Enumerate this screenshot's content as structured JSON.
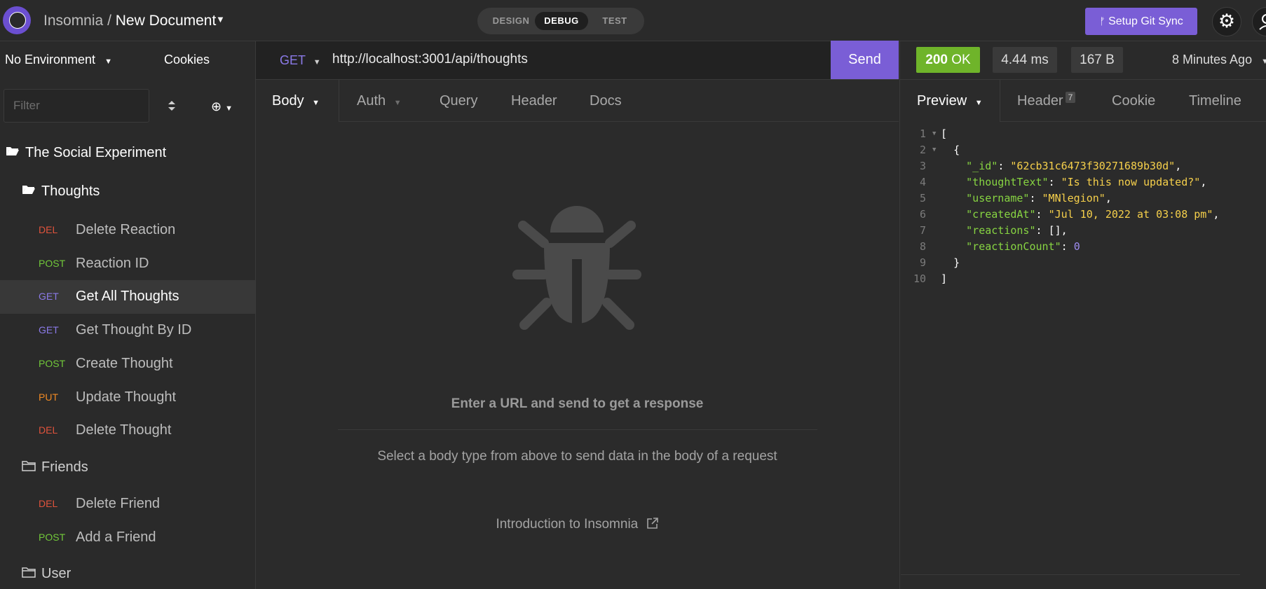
{
  "colors": {
    "accent": "#7a5ed6",
    "status_ok": "#6fb42a",
    "method_get": "#8b7ae8",
    "method_post": "#72c93a",
    "method_put": "#f08a24",
    "method_del": "#e0533c"
  },
  "header": {
    "app_name": "Insomnia",
    "separator": "/",
    "document_name": "New Document",
    "modes": {
      "design": "DESIGN",
      "debug": "DEBUG",
      "test": "TEST"
    },
    "git_sync_label": "Setup Git Sync",
    "icons": {
      "logo": "insomnia-logo",
      "git": "git-branch-icon",
      "settings": "gear-icon",
      "account": "user-icon"
    }
  },
  "sidebar": {
    "environment": "No Environment",
    "cookies": "Cookies",
    "filter_placeholder": "Filter",
    "workspace": "The Social Experiment",
    "folders": [
      {
        "name": "Thoughts"
      },
      {
        "name": "Friends"
      },
      {
        "name": "User"
      }
    ],
    "requests": [
      {
        "method": "DEL",
        "name": "Delete Reaction"
      },
      {
        "method": "POST",
        "name": "Reaction ID"
      },
      {
        "method": "GET",
        "name": "Get All Thoughts",
        "active": true
      },
      {
        "method": "GET",
        "name": "Get Thought By ID"
      },
      {
        "method": "POST",
        "name": "Create Thought"
      },
      {
        "method": "PUT",
        "name": "Update Thought"
      },
      {
        "method": "DEL",
        "name": "Delete Thought"
      },
      {
        "method": "DEL",
        "name": "Delete Friend"
      },
      {
        "method": "POST",
        "name": "Add a Friend"
      }
    ]
  },
  "request": {
    "method": "GET",
    "url": "http://localhost:3001/api/thoughts",
    "send_label": "Send",
    "tabs": {
      "body": "Body",
      "auth": "Auth",
      "query": "Query",
      "header": "Header",
      "docs": "Docs"
    },
    "empty_title": "Enter a URL and send to get a response",
    "empty_subtitle": "Select a body type from above to send data in the body of a request",
    "intro_link": "Introduction to Insomnia"
  },
  "response": {
    "status_code": "200",
    "status_text": "OK",
    "time": "4.44 ms",
    "size": "167 B",
    "ago": "8 Minutes Ago",
    "tabs": {
      "preview": "Preview",
      "header": "Header",
      "header_count": "7",
      "cookie": "Cookie",
      "timeline": "Timeline"
    },
    "lines": [
      {
        "n": "1",
        "fold": "▼",
        "indent": "",
        "open": "["
      },
      {
        "n": "2",
        "fold": "▼",
        "indent": "  ",
        "open": "{"
      },
      {
        "n": "3",
        "indent": "    ",
        "key": "\"_id\"",
        "sep": ": ",
        "str": "\"62cb31c6473f30271689b30d\"",
        "tail": ","
      },
      {
        "n": "4",
        "indent": "    ",
        "key": "\"thoughtText\"",
        "sep": ": ",
        "str": "\"Is this now updated?\"",
        "tail": ","
      },
      {
        "n": "5",
        "indent": "    ",
        "key": "\"username\"",
        "sep": ": ",
        "str": "\"MNlegion\"",
        "tail": ","
      },
      {
        "n": "6",
        "indent": "    ",
        "key": "\"createdAt\"",
        "sep": ": ",
        "str": "\"Jul 10, 2022 at 03:08 pm\"",
        "tail": ","
      },
      {
        "n": "7",
        "indent": "    ",
        "key": "\"reactions\"",
        "sep": ": ",
        "plain": "[]",
        "tail": ","
      },
      {
        "n": "8",
        "indent": "    ",
        "key": "\"reactionCount\"",
        "sep": ": ",
        "num": "0"
      },
      {
        "n": "9",
        "indent": "  ",
        "open": "}"
      },
      {
        "n": "10",
        "indent": "",
        "open": "]"
      }
    ]
  }
}
